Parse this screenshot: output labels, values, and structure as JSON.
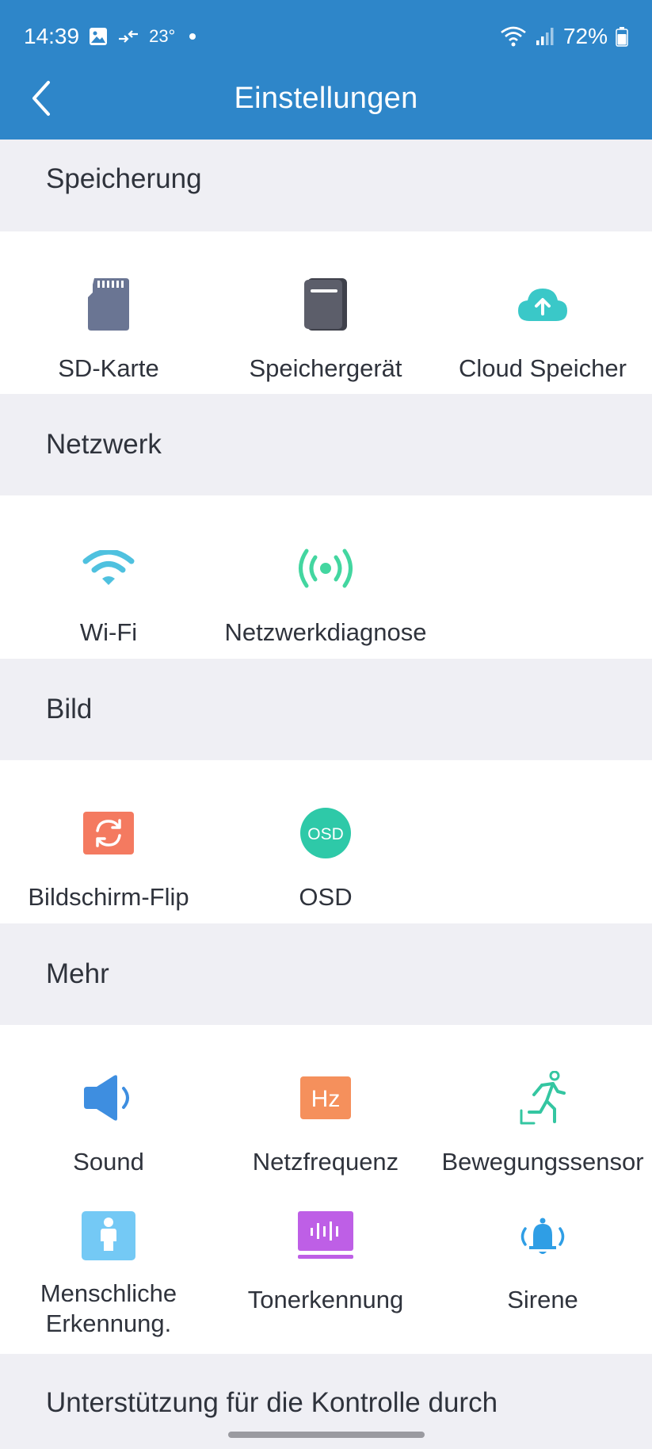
{
  "status": {
    "time": "14:39",
    "temp": "23°",
    "battery": "72%"
  },
  "header": {
    "title": "Einstellungen"
  },
  "sections": [
    {
      "title": "Speicherung",
      "items": [
        {
          "label": "SD-Karte",
          "icon": "sd-card-icon"
        },
        {
          "label": "Speichergerät",
          "icon": "storage-device-icon"
        },
        {
          "label": "Cloud Speicher",
          "icon": "cloud-upload-icon"
        }
      ]
    },
    {
      "title": "Netzwerk",
      "items": [
        {
          "label": "Wi-Fi",
          "icon": "wifi-icon"
        },
        {
          "label": "Netzwerkdiagnose",
          "icon": "signal-broadcast-icon"
        }
      ]
    },
    {
      "title": "Bild",
      "items": [
        {
          "label": "Bildschirm-Flip",
          "icon": "flip-icon"
        },
        {
          "label": "OSD",
          "icon": "osd-icon",
          "badge": "OSD"
        }
      ]
    },
    {
      "title": "Mehr",
      "items": [
        {
          "label": "Sound",
          "icon": "speaker-icon"
        },
        {
          "label": "Netzfrequenz",
          "icon": "hz-icon",
          "badge": "Hz"
        },
        {
          "label": "Bewegungssensor",
          "icon": "running-person-icon"
        },
        {
          "label": "Menschliche\nErkennung.",
          "line1": "Menschliche",
          "line2": "Erkennung.",
          "icon": "person-detection-icon"
        },
        {
          "label": "Tonerkennung",
          "icon": "sound-wave-icon"
        },
        {
          "label": "Sirene",
          "icon": "bell-icon"
        }
      ]
    }
  ],
  "footer": {
    "text": "Unterstützung für die Kontrolle durch"
  },
  "colors": {
    "topbar": "#2e86c9",
    "background": "#efeff4",
    "card": "#ffffff",
    "sd_card": "#6a7593",
    "storage": "#5c5e6a",
    "cloud": "#3ac8c8",
    "wifi": "#4fc1df",
    "diagnose": "#43d6a0",
    "flip": "#f47a60",
    "osd": "#2ec9a8",
    "sound": "#3e8ee0",
    "hz": "#f5905c",
    "motion": "#34c6a1",
    "person": "#74c9f5",
    "tone": "#be5fe6",
    "siren": "#2f9ee5"
  }
}
